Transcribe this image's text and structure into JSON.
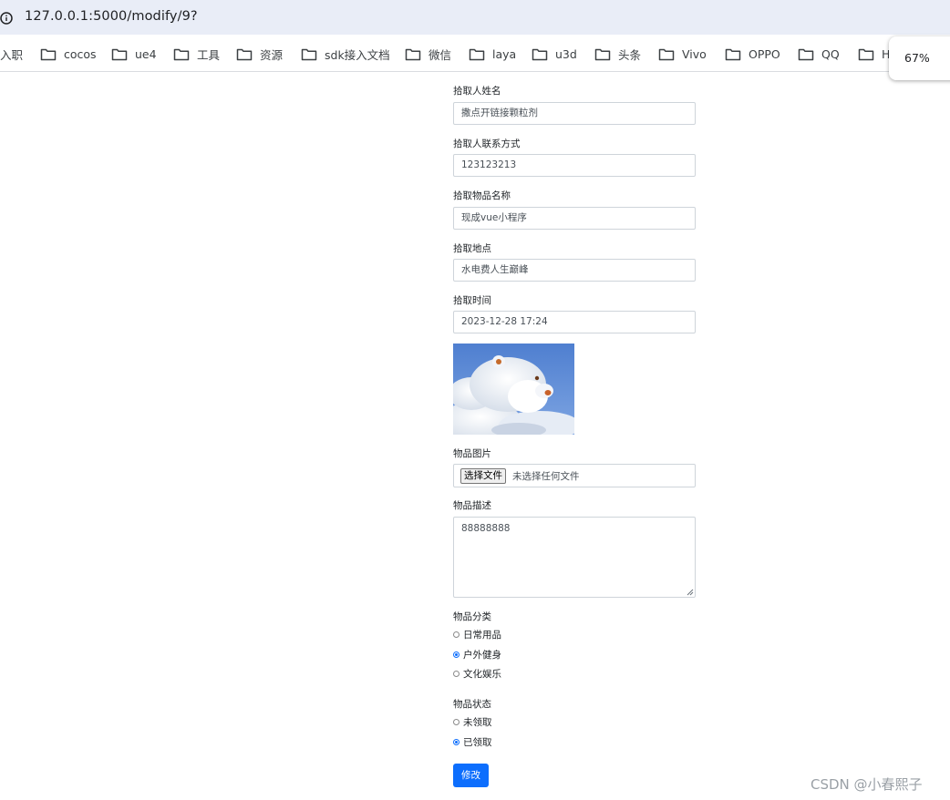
{
  "browser": {
    "url": "127.0.0.1:5000/modify/9?",
    "zoom": "67%",
    "bookmarks": [
      "入职",
      "cocos",
      "ue4",
      "工具",
      "资源",
      "sdk接入文档",
      "微信",
      "laya",
      "u3d",
      "头条",
      "Vivo",
      "OPPO",
      "QQ",
      "H"
    ]
  },
  "form": {
    "name_label": "拾取人姓名",
    "name_value": "撒点开链接颗粒剂",
    "contact_label": "拾取人联系方式",
    "contact_value": "123123213",
    "item_label": "拾取物品名称",
    "item_value": "现成vue小程序",
    "place_label": "拾取地点",
    "place_value": "水电费人生巅峰",
    "time_label": "拾取时间",
    "time_value": "2023-12-28 17:24",
    "image_label": "物品图片",
    "file_button": "选择文件",
    "file_status": "未选择任何文件",
    "desc_label": "物品描述",
    "desc_value": "88888888",
    "category_label": "物品分类",
    "categories": [
      {
        "label": "日常用品",
        "checked": false
      },
      {
        "label": "户外健身",
        "checked": true
      },
      {
        "label": "文化娱乐",
        "checked": false
      }
    ],
    "status_label": "物品状态",
    "statuses": [
      {
        "label": "未领取",
        "checked": false
      },
      {
        "label": "已领取",
        "checked": true
      }
    ],
    "submit_label": "修改"
  },
  "watermark": "CSDN @小春熙子",
  "colors": {
    "accent": "#0d6efd",
    "address_bar": "#e9edf7"
  }
}
